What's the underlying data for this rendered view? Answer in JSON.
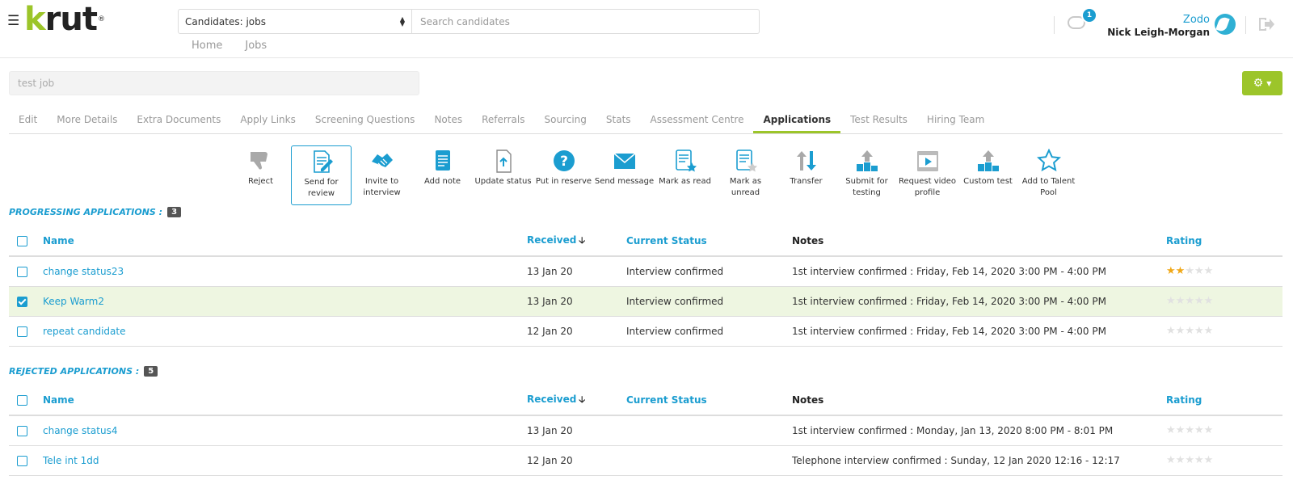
{
  "header": {
    "logo_text": "krut",
    "logo_mark": "®",
    "scope_select_value": "Candidates: jobs",
    "search_placeholder": "Search candidates",
    "nav": [
      "Home",
      "Jobs"
    ],
    "notification_count": "1",
    "company": "Zodo",
    "user_name": "Nick Leigh-Morgan"
  },
  "job": {
    "title": "test job"
  },
  "tabs": [
    {
      "label": "Edit"
    },
    {
      "label": "More Details"
    },
    {
      "label": "Extra Documents"
    },
    {
      "label": "Apply Links"
    },
    {
      "label": "Screening Questions"
    },
    {
      "label": "Notes"
    },
    {
      "label": "Referrals"
    },
    {
      "label": "Sourcing"
    },
    {
      "label": "Stats"
    },
    {
      "label": "Assessment Centre"
    },
    {
      "label": "Applications",
      "active": true
    },
    {
      "label": "Test Results"
    },
    {
      "label": "Hiring Team"
    }
  ],
  "toolbar": [
    {
      "label": "Reject",
      "icon": "thumbs-down-icon"
    },
    {
      "label": "Send for review",
      "icon": "document-pen-icon",
      "selected": true
    },
    {
      "label": "Invite to interview",
      "icon": "handshake-icon"
    },
    {
      "label": "Add note",
      "icon": "note-icon"
    },
    {
      "label": "Update status",
      "icon": "file-upload-icon"
    },
    {
      "label": "Put in reserve",
      "icon": "question-circle-icon"
    },
    {
      "label": "Send message",
      "icon": "envelope-icon"
    },
    {
      "label": "Mark as read",
      "icon": "document-star-icon"
    },
    {
      "label": "Mark as unread",
      "icon": "document-star-outline-icon"
    },
    {
      "label": "Transfer",
      "icon": "transfer-arrows-icon"
    },
    {
      "label": "Submit for testing",
      "icon": "podium-upload-icon"
    },
    {
      "label": "Request video profile",
      "icon": "video-film-icon"
    },
    {
      "label": "Custom test",
      "icon": "podium-upload-icon"
    },
    {
      "label": "Add to Talent Pool",
      "icon": "star-outline-icon"
    }
  ],
  "progressing": {
    "heading": "PROGRESSING APPLICATIONS :",
    "count": "3",
    "columns": {
      "name": "Name",
      "received": "Received",
      "status": "Current Status",
      "notes": "Notes",
      "rating": "Rating"
    },
    "rows": [
      {
        "name": "change status23",
        "received": "13 Jan 20",
        "status": "Interview confirmed",
        "notes": "1st interview confirmed : Friday, Feb 14, 2020 3:00 PM - 4:00 PM",
        "rating": 2,
        "checked": false
      },
      {
        "name": "Keep Warm2",
        "received": "13 Jan 20",
        "status": "Interview confirmed",
        "notes": "1st interview confirmed : Friday, Feb 14, 2020 3:00 PM - 4:00 PM",
        "rating": 0,
        "checked": true
      },
      {
        "name": "repeat candidate",
        "received": "12 Jan 20",
        "status": "Interview confirmed",
        "notes": "1st interview confirmed : Friday, Feb 14, 2020 3:00 PM - 4:00 PM",
        "rating": 0,
        "checked": false
      }
    ]
  },
  "rejected": {
    "heading": "REJECTED APPLICATIONS :",
    "count": "5",
    "columns": {
      "name": "Name",
      "received": "Received",
      "status": "Current Status",
      "notes": "Notes",
      "rating": "Rating"
    },
    "rows": [
      {
        "name": "change status4",
        "received": "13 Jan 20",
        "status": "",
        "notes": "1st interview confirmed : Monday, Jan 13, 2020 8:00 PM - 8:01 PM",
        "rating": 0,
        "checked": false
      },
      {
        "name": "Tele int 1dd",
        "received": "12 Jan 20",
        "status": "",
        "notes": "Telephone interview confirmed : Sunday, 12 Jan 2020 12:16 - 12:17",
        "rating": 0,
        "checked": false
      }
    ]
  },
  "colors": {
    "accent_blue": "#1b9dd0",
    "accent_green": "#9cc52a",
    "star_on": "#f0a818"
  }
}
